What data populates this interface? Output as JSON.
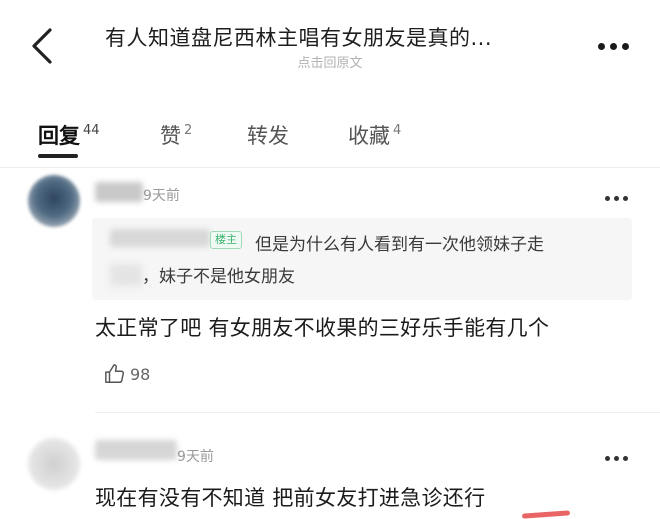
{
  "header": {
    "title": "有人知道盘尼西林主唱有女朋友是真的...",
    "subtitle": "点击回原文"
  },
  "tabs": [
    {
      "label": "回复",
      "count": "44",
      "active": true
    },
    {
      "label": "赞",
      "count": "2",
      "active": false
    },
    {
      "label": "转发",
      "count": "",
      "active": false
    },
    {
      "label": "收藏",
      "count": "4",
      "active": false
    }
  ],
  "comments": [
    {
      "time": "9天前",
      "quote": {
        "badge": "楼主",
        "text": "但是为什么有人看到有一次他领妹子走",
        "text_cont": "，妹子不是他女朋友"
      },
      "text": "太正常了吧 有女朋友不收果的三好乐手能有几个",
      "likes": "98"
    },
    {
      "time": "9天前",
      "text": "现在有没有不知道 把前女友打进急诊还行"
    }
  ],
  "icons": {
    "back": "back-arrow-icon",
    "more": "more-dots-icon",
    "like": "thumbs-up-icon"
  }
}
